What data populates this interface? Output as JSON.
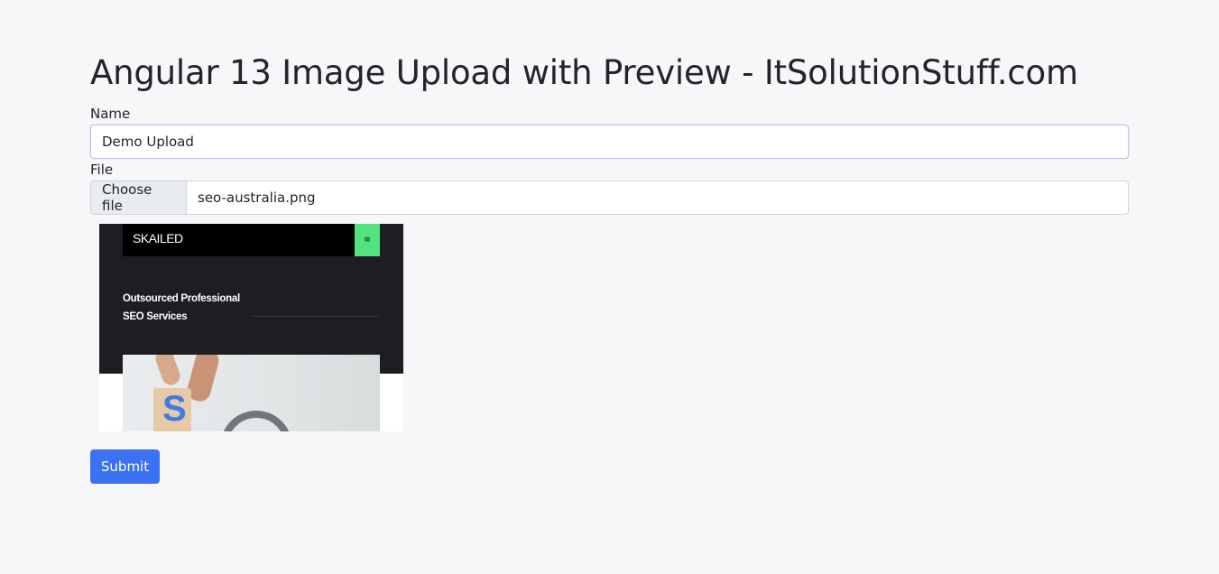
{
  "page": {
    "title": "Angular 13 Image Upload with Preview - ItSolutionStuff.com"
  },
  "form": {
    "name_label": "Name",
    "name_value": "Demo Upload",
    "file_label": "File",
    "choose_file_label": "Choose file",
    "file_name": "seo-australia.png",
    "submit_label": "Submit"
  },
  "preview": {
    "logo": "SKAILED",
    "menu_glyph": "≡",
    "headline_line1": "Outsourced Professional",
    "headline_line2": "SEO Services",
    "block_letter": "S",
    "menu_color": "#54e27e"
  },
  "colors": {
    "primary": "#3b71f3",
    "background": "#f7f7f9"
  }
}
